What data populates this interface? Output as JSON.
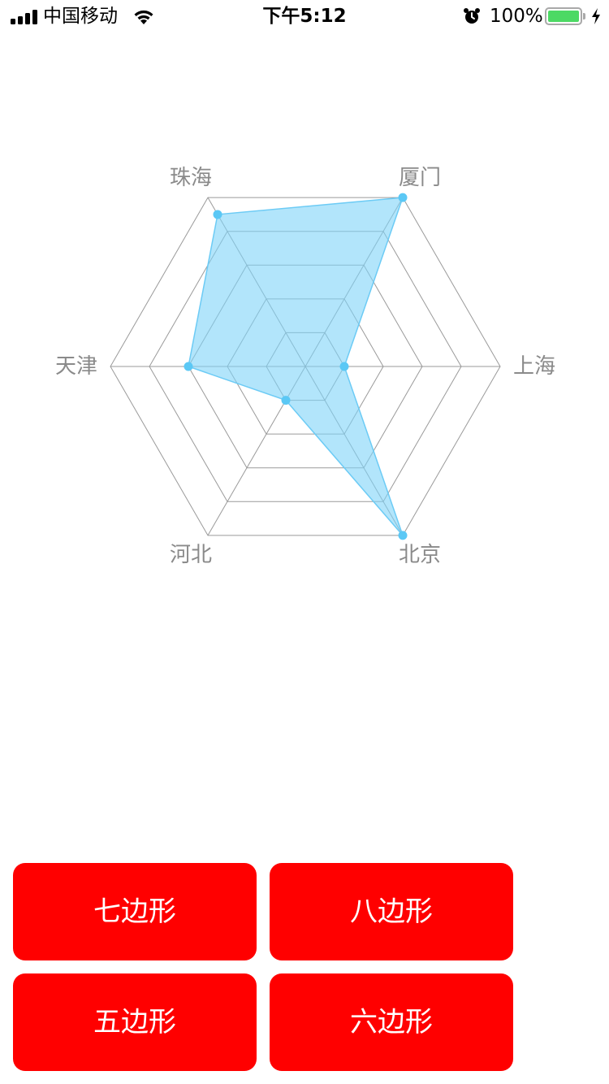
{
  "status_bar": {
    "carrier": "中国移动",
    "time": "下午5:12",
    "battery_percent": "100%",
    "battery_level": 1.0,
    "icons": [
      "signal-icon",
      "wifi-icon",
      "alarm-icon",
      "battery-icon",
      "charging-bolt-icon"
    ]
  },
  "chart_data": {
    "type": "radar",
    "title": "",
    "axes": [
      "上海",
      "厦门",
      "珠海",
      "天津",
      "河北",
      "北京"
    ],
    "rings": 5,
    "range": [
      0,
      5
    ],
    "grid": true,
    "series": [
      {
        "values": [
          1.0,
          5.0,
          4.5,
          3.0,
          1.0,
          5.0
        ],
        "fill_color": "#7fd4f9",
        "line_color": "#6ccbf5",
        "point_color": "#5bc8f5"
      }
    ]
  },
  "buttons": {
    "heptagon": "七边形",
    "octagon": "八边形",
    "pentagon": "五边形",
    "hexagon": "六边形"
  }
}
